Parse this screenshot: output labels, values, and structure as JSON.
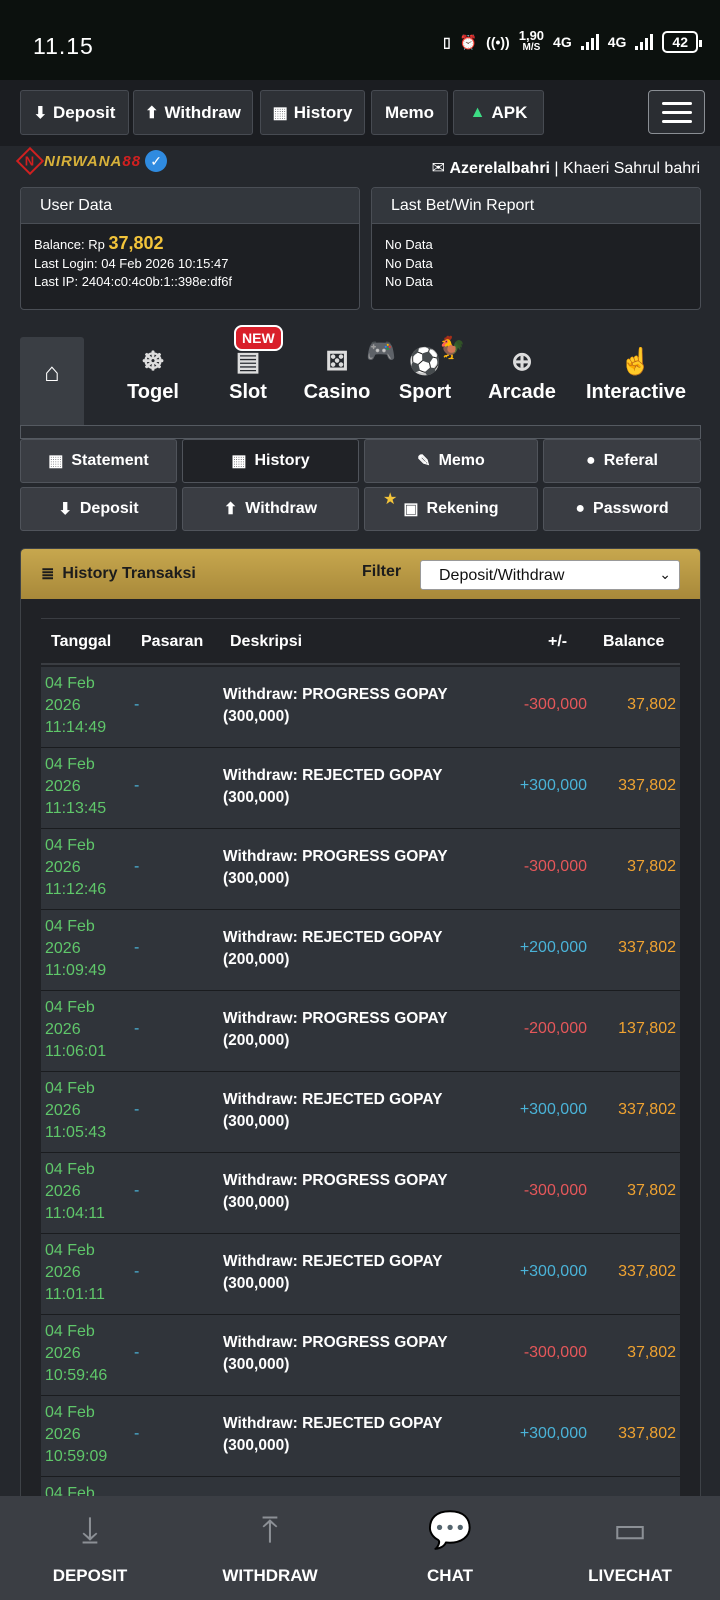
{
  "status": {
    "time": "11.15",
    "speed_value": "1,90",
    "speed_unit": "M/S",
    "net1": "4G",
    "net2": "4G",
    "battery": "42"
  },
  "topnav": {
    "deposit": "Deposit",
    "withdraw": "Withdraw",
    "history": "History",
    "memo": "Memo",
    "apk": "APK"
  },
  "brand": {
    "logo_a": "NIRWANA",
    "logo_b": "88"
  },
  "user": {
    "username": "Azerelalbahri",
    "separator": " | ",
    "fullname": "Khaeri Sahrul bahri"
  },
  "user_data": {
    "title": "User Data",
    "balance_label": "Balance: Rp ",
    "balance_value": "37,802",
    "last_login": "Last Login: 04 Feb 2026 10:15:47",
    "last_ip": "Last IP: 2404:c0:4c0b:1::398e:df6f"
  },
  "last_bet": {
    "title": "Last Bet/Win Report",
    "line1": "No Data",
    "line2": "No Data",
    "line3": "No Data"
  },
  "game_tabs": {
    "togel": "Togel",
    "slot": "Slot",
    "casino": "Casino",
    "sport": "Sport",
    "arcade": "Arcade",
    "interactive": "Interactive",
    "new_badge": "NEW"
  },
  "menu": {
    "statement": "Statement",
    "history": "History",
    "memo": "Memo",
    "referal": "Referal",
    "deposit": "Deposit",
    "withdraw": "Withdraw",
    "rekening": "Rekening",
    "password": "Password"
  },
  "history": {
    "title": "History Transaksi",
    "filter_label": "Filter",
    "filter_value": "Deposit/Withdraw",
    "columns": {
      "tanggal": "Tanggal",
      "pasaran": "Pasaran",
      "deskripsi": "Deskripsi",
      "plusminus": "+/-",
      "balance": "Balance"
    },
    "rows": [
      {
        "d1": "04 Feb",
        "d2": "2026",
        "d3": "11:14:49",
        "pasaran": "-",
        "desc1": "Withdraw: PROGRESS GOPAY",
        "desc2": "(300,000)",
        "amount": "-300,000",
        "balance": "37,802"
      },
      {
        "d1": "04 Feb",
        "d2": "2026",
        "d3": "11:13:45",
        "pasaran": "-",
        "desc1": "Withdraw: REJECTED GOPAY",
        "desc2": "(300,000)",
        "amount": "+300,000",
        "balance": "337,802"
      },
      {
        "d1": "04 Feb",
        "d2": "2026",
        "d3": "11:12:46",
        "pasaran": "-",
        "desc1": "Withdraw: PROGRESS GOPAY",
        "desc2": "(300,000)",
        "amount": "-300,000",
        "balance": "37,802"
      },
      {
        "d1": "04 Feb",
        "d2": "2026",
        "d3": "11:09:49",
        "pasaran": "-",
        "desc1": "Withdraw: REJECTED GOPAY",
        "desc2": "(200,000)",
        "amount": "+200,000",
        "balance": "337,802"
      },
      {
        "d1": "04 Feb",
        "d2": "2026",
        "d3": "11:06:01",
        "pasaran": "-",
        "desc1": "Withdraw: PROGRESS GOPAY",
        "desc2": "(200,000)",
        "amount": "-200,000",
        "balance": "137,802"
      },
      {
        "d1": "04 Feb",
        "d2": "2026",
        "d3": "11:05:43",
        "pasaran": "-",
        "desc1": "Withdraw: REJECTED GOPAY",
        "desc2": "(300,000)",
        "amount": "+300,000",
        "balance": "337,802"
      },
      {
        "d1": "04 Feb",
        "d2": "2026",
        "d3": "11:04:11",
        "pasaran": "-",
        "desc1": "Withdraw: PROGRESS GOPAY",
        "desc2": "(300,000)",
        "amount": "-300,000",
        "balance": "37,802"
      },
      {
        "d1": "04 Feb",
        "d2": "2026",
        "d3": "11:01:11",
        "pasaran": "-",
        "desc1": "Withdraw: REJECTED GOPAY",
        "desc2": "(300,000)",
        "amount": "+300,000",
        "balance": "337,802"
      },
      {
        "d1": "04 Feb",
        "d2": "2026",
        "d3": "10:59:46",
        "pasaran": "-",
        "desc1": "Withdraw: PROGRESS GOPAY",
        "desc2": "(300,000)",
        "amount": "-300,000",
        "balance": "37,802"
      },
      {
        "d1": "04 Feb",
        "d2": "2026",
        "d3": "10:59:09",
        "pasaran": "-",
        "desc1": "Withdraw: REJECTED GOPAY",
        "desc2": "(300,000)",
        "amount": "+300,000",
        "balance": "337,802"
      },
      {
        "d1": "04 Feb",
        "d2": "",
        "d3": "",
        "pasaran": "",
        "desc1": "",
        "desc2": "",
        "amount": "",
        "balance": ""
      }
    ]
  },
  "bottombar": {
    "deposit": "DEPOSIT",
    "withdraw": "WITHDRAW",
    "chat": "CHAT",
    "livechat": "LIVECHAT"
  }
}
